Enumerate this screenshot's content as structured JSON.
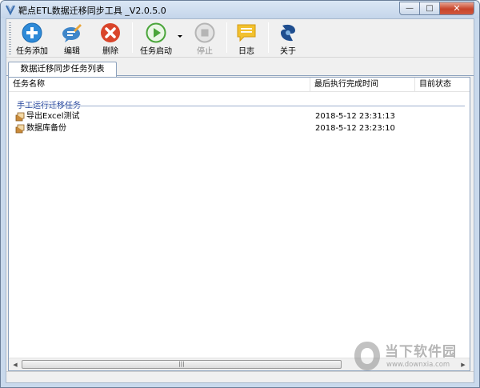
{
  "window": {
    "title": "靶点ETL数据迁移同步工具 _V2.0.5.0",
    "minimize_glyph": "—",
    "maximize_glyph": "□",
    "close_glyph": "✕"
  },
  "toolbar": {
    "add_label": "任务添加",
    "edit_label": "编辑",
    "delete_label": "删除",
    "start_label": "任务启动",
    "stop_label": "停止",
    "log_label": "日志",
    "about_label": "关于"
  },
  "tabs": [
    {
      "label": "数据迁移同步任务列表",
      "active": true
    }
  ],
  "table": {
    "columns": [
      "任务名称",
      "最后执行完成时间",
      "目前状态"
    ],
    "group": "手工运行迁移任务",
    "rows": [
      {
        "name": "导出Excel测试",
        "last_run": "2018-5-12 23:31:13",
        "status": ""
      },
      {
        "name": "数据库备份",
        "last_run": "2018-5-12 23:23:10",
        "status": ""
      }
    ]
  },
  "scrollbar": {
    "thumb_glyph": "|||",
    "left_glyph": "◀",
    "right_glyph": "▶"
  },
  "watermark": {
    "text": "当下软件园",
    "url": "www.downxia.com"
  },
  "colors": {
    "group_header": "#1e3f9a",
    "add_icon": "#2e8ad8",
    "delete_icon": "#d9452b",
    "start_icon": "#4aa53a",
    "log_icon": "#f2c12e"
  }
}
